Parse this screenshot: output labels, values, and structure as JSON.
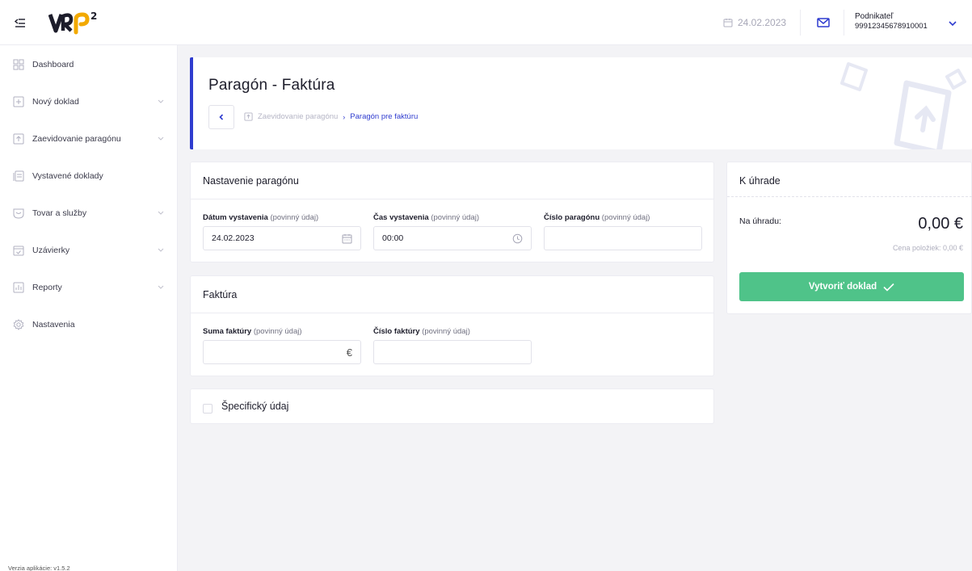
{
  "topbar": {
    "date": "24.02.2023",
    "user_name": "Podnikateľ",
    "user_number": "99912345678910001"
  },
  "logo": {
    "text": "VRP",
    "superscript": "2"
  },
  "sidebar": {
    "items": [
      {
        "label": "Dashboard",
        "icon": "dashboard-icon",
        "expandable": false
      },
      {
        "label": "Nový doklad",
        "icon": "new-document-icon",
        "expandable": true
      },
      {
        "label": "Zaevidovanie paragónu",
        "icon": "upload-document-icon",
        "expandable": true
      },
      {
        "label": "Vystavené doklady",
        "icon": "documents-icon",
        "expandable": false
      },
      {
        "label": "Tovar a služby",
        "icon": "goods-icon",
        "expandable": true
      },
      {
        "label": "Uzávierky",
        "icon": "calendar-check-icon",
        "expandable": true
      },
      {
        "label": "Reporty",
        "icon": "chart-icon",
        "expandable": true
      },
      {
        "label": "Nastavenia",
        "icon": "gear-icon",
        "expandable": false
      }
    ],
    "version": "Verzia aplikácie: v1.5.2"
  },
  "header": {
    "title": "Paragón - Faktúra",
    "breadcrumb_prev": "Zaevidovanie paragónu",
    "breadcrumb_sep": "›",
    "breadcrumb_current": "Paragón pre faktúru"
  },
  "settings_card": {
    "title": "Nastavenie paragónu",
    "date_label": "Dátum vystavenia",
    "date_optional": "(povinný údaj)",
    "date_value": "24.02.2023",
    "time_label": "Čas vystavenia",
    "time_optional": "(povinný údaj)",
    "time_value": "00:00",
    "number_label": "Číslo paragónu",
    "number_optional": "(povinný údaj)",
    "number_value": ""
  },
  "invoice_card": {
    "title": "Faktúra",
    "sum_label": "Suma faktúry",
    "sum_optional": "(povinný údaj)",
    "sum_value": "",
    "currency": "€",
    "invoice_number_label": "Číslo faktúry",
    "invoice_number_optional": "(povinný údaj)",
    "invoice_number_value": ""
  },
  "specific_card": {
    "label": "Špecifický údaj",
    "checked": false
  },
  "payment_card": {
    "title": "K úhrade",
    "to_pay_label": "Na úhradu:",
    "amount": "0,00 €",
    "items_price": "Cena položiek: 0,00 €",
    "create_button": "Vytvoriť doklad"
  },
  "colors": {
    "accent": "#2f3ccf",
    "success": "#4fc389",
    "background": "#f3f3f6"
  }
}
